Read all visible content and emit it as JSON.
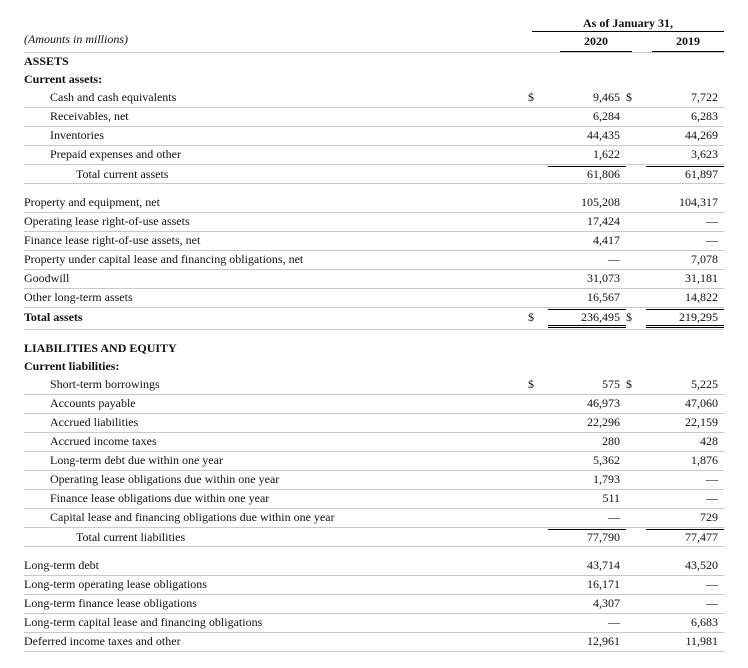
{
  "meta": {
    "period_header": "As of January 31,",
    "caption": "(Amounts in millions)",
    "year1": "2020",
    "year2": "2019"
  },
  "sections": {
    "assets_title": "ASSETS",
    "current_assets_title": "Current assets:",
    "liab_title": "LIABILITIES AND EQUITY",
    "current_liab_title": "Current liabilities:"
  },
  "currency": "$",
  "rows": {
    "cash": {
      "label": "Cash and cash equivalents",
      "v1": "9,465",
      "v2": "7,722"
    },
    "receivables": {
      "label": "Receivables, net",
      "v1": "6,284",
      "v2": "6,283"
    },
    "inventories": {
      "label": "Inventories",
      "v1": "44,435",
      "v2": "44,269"
    },
    "prepaid": {
      "label": "Prepaid expenses and other",
      "v1": "1,622",
      "v2": "3,623"
    },
    "tca": {
      "label": "Total current assets",
      "v1": "61,806",
      "v2": "61,897"
    },
    "ppe": {
      "label": "Property and equipment, net",
      "v1": "105,208",
      "v2": "104,317"
    },
    "op_rou": {
      "label": "Operating lease right-of-use assets",
      "v1": "17,424",
      "v2": "—"
    },
    "fin_rou": {
      "label": "Finance lease right-of-use assets, net",
      "v1": "4,417",
      "v2": "—"
    },
    "cap_lease_prop": {
      "label": "Property under capital lease and financing obligations, net",
      "v1": "—",
      "v2": "7,078"
    },
    "goodwill": {
      "label": "Goodwill",
      "v1": "31,073",
      "v2": "31,181"
    },
    "other_lt": {
      "label": "Other long-term assets",
      "v1": "16,567",
      "v2": "14,822"
    },
    "total_assets": {
      "label": "Total assets",
      "v1": "236,495",
      "v2": "219,295"
    },
    "st_borrow": {
      "label": "Short-term borrowings",
      "v1": "575",
      "v2": "5,225"
    },
    "ap": {
      "label": "Accounts payable",
      "v1": "46,973",
      "v2": "47,060"
    },
    "accrued": {
      "label": "Accrued liabilities",
      "v1": "22,296",
      "v2": "22,159"
    },
    "inc_tax": {
      "label": "Accrued income taxes",
      "v1": "280",
      "v2": "428"
    },
    "ltd_current": {
      "label": "Long-term debt due within one year",
      "v1": "5,362",
      "v2": "1,876"
    },
    "op_lease_cur": {
      "label": "Operating lease obligations due within one year",
      "v1": "1,793",
      "v2": "—"
    },
    "fin_lease_cur": {
      "label": "Finance lease obligations due within one year",
      "v1": "511",
      "v2": "—"
    },
    "cap_lease_cur": {
      "label": "Capital lease and financing obligations due within one year",
      "v1": "—",
      "v2": "729"
    },
    "tcl": {
      "label": "Total current liabilities",
      "v1": "77,790",
      "v2": "77,477"
    },
    "ltd": {
      "label": "Long-term debt",
      "v1": "43,714",
      "v2": "43,520"
    },
    "lt_op_lease": {
      "label": "Long-term operating lease obligations",
      "v1": "16,171",
      "v2": "—"
    },
    "lt_fin_lease": {
      "label": "Long-term finance lease obligations",
      "v1": "4,307",
      "v2": "—"
    },
    "lt_cap_lease": {
      "label": "Long-term capital lease and financing obligations",
      "v1": "—",
      "v2": "6,683"
    },
    "def_tax": {
      "label": "Deferred income taxes and other",
      "v1": "12,961",
      "v2": "11,981"
    }
  }
}
